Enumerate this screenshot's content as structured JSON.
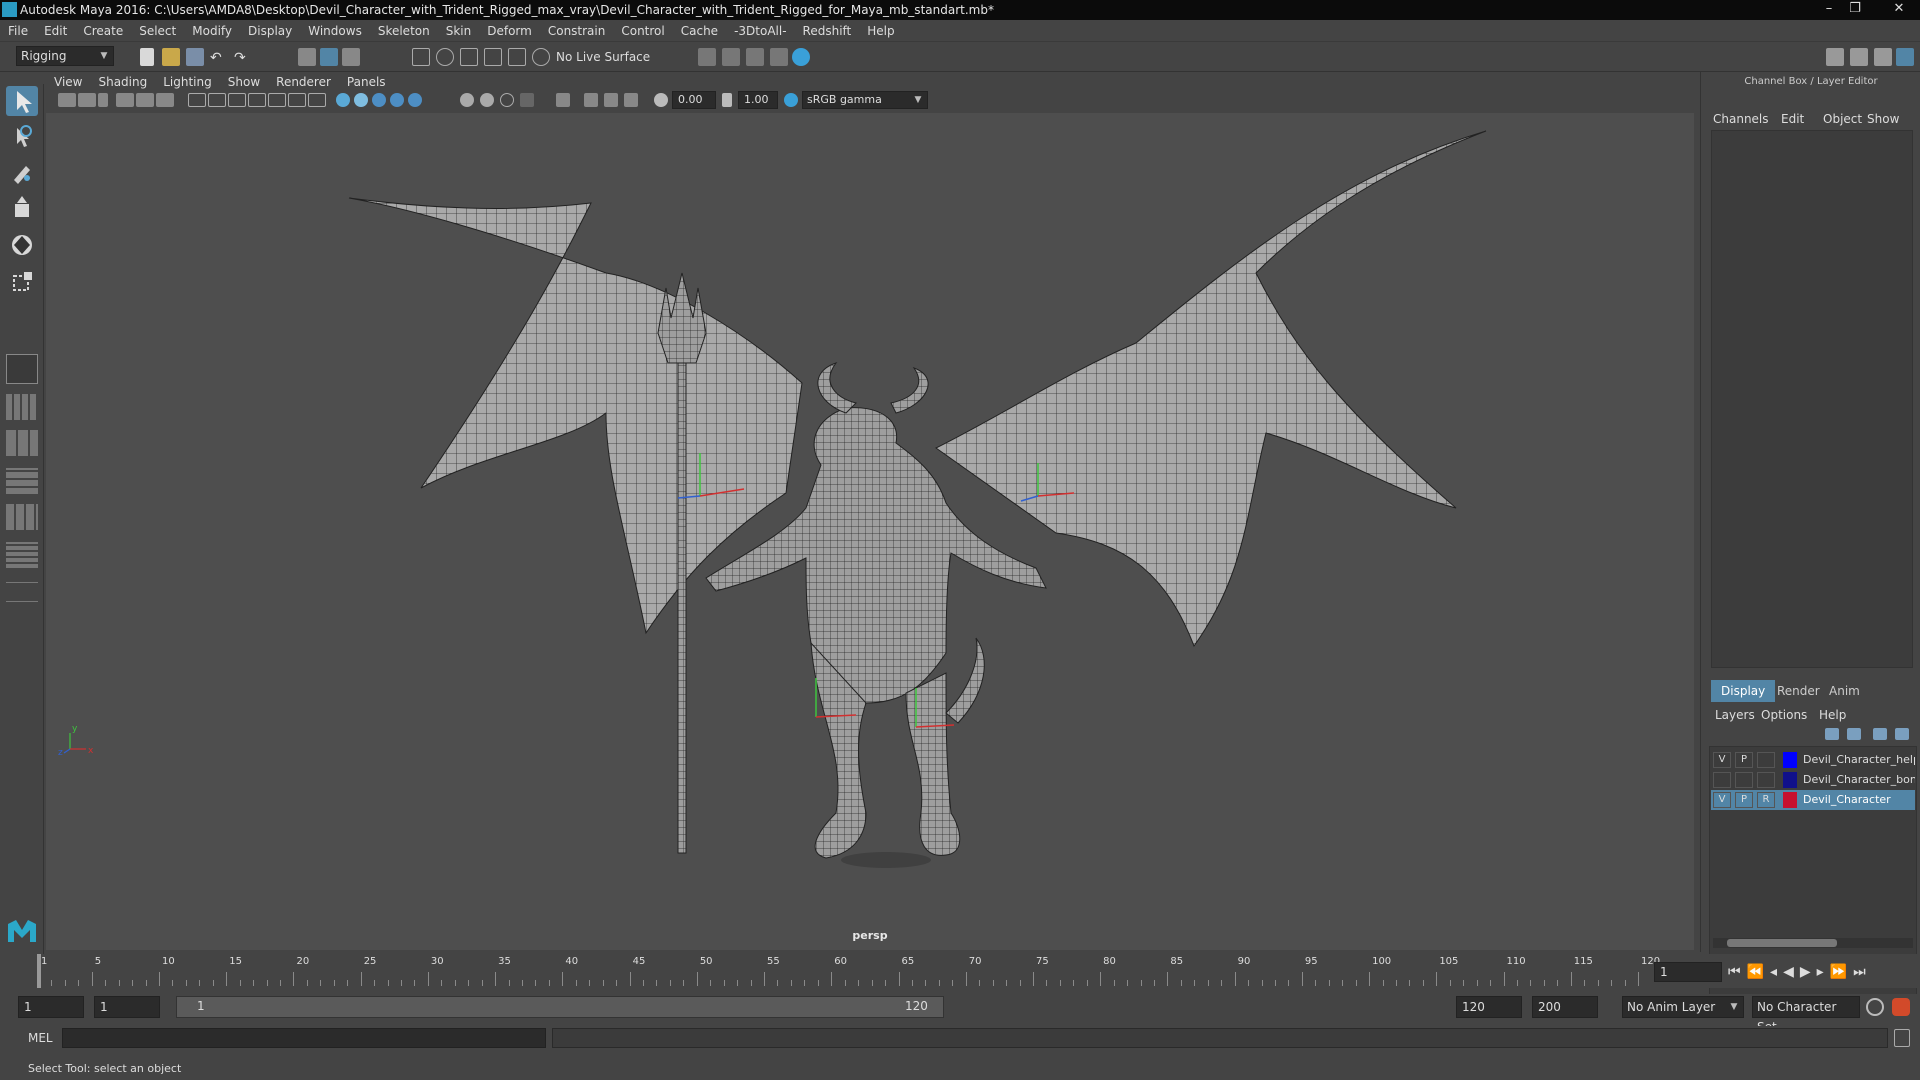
{
  "window": {
    "title": "Autodesk Maya 2016: C:\\Users\\AMDA8\\Desktop\\Devil_Character_with_Trident_Rigged_max_vray\\Devil_Character_with_Trident_Rigged_for_Maya_mb_standart.mb*",
    "minimize": "–",
    "maximize": "❐",
    "close": "✕"
  },
  "menu": [
    "File",
    "Edit",
    "Create",
    "Select",
    "Modify",
    "Display",
    "Windows",
    "Skeleton",
    "Skin",
    "Deform",
    "Constrain",
    "Control",
    "Cache",
    "-3DtoAll-",
    "Redshift",
    "Help"
  ],
  "shelf": {
    "menuset": "Rigging",
    "live_surface": "No Live Surface"
  },
  "panel_menu": [
    "View",
    "Shading",
    "Lighting",
    "Show",
    "Renderer",
    "Panels"
  ],
  "panel_toolbar": {
    "exposure": "0.00",
    "gamma": "1.00",
    "color_space": "sRGB gamma"
  },
  "viewport": {
    "camera_label": "persp",
    "axis_y": "y",
    "axis_x": "x",
    "axis_z": "z"
  },
  "right_panel": {
    "title": "Channel Box / Layer Editor",
    "channel_tabs": [
      "Channels",
      "Edit",
      "Object",
      "Show"
    ],
    "display_tabs": [
      "Display",
      "Render",
      "Anim"
    ],
    "layer_menu": [
      "Layers",
      "Options",
      "Help"
    ],
    "layers": [
      {
        "v": "V",
        "p": "P",
        "r": "",
        "name": "Devil_Character_helpe",
        "color": "#0000ff",
        "selected": false
      },
      {
        "v": "",
        "p": "",
        "r": "",
        "name": "Devil_Character_bones",
        "color": "#10108a",
        "selected": false
      },
      {
        "v": "V",
        "p": "P",
        "r": "R",
        "name": "Devil_Character",
        "color": "#c8102e",
        "selected": true
      }
    ]
  },
  "timeline": {
    "ticks": [
      "1",
      "5",
      "10",
      "15",
      "20",
      "25",
      "30",
      "35",
      "40",
      "45",
      "50",
      "55",
      "60",
      "65",
      "70",
      "75",
      "80",
      "85",
      "90",
      "95",
      "100",
      "105",
      "110",
      "115",
      "120"
    ],
    "current_frame": "1"
  },
  "range": {
    "start": "1",
    "inner_start": "1",
    "slider_start": "1",
    "slider_end": "120",
    "end": "120",
    "max": "200",
    "anim_layer": "No Anim Layer",
    "char_set": "No Character Set"
  },
  "mel": {
    "label": "MEL"
  },
  "help_line": "Select Tool: select an object",
  "colors": {
    "accent": "#5285a6",
    "viewport_bg": "#4e4e4e",
    "selected_row": "#5285a6"
  }
}
